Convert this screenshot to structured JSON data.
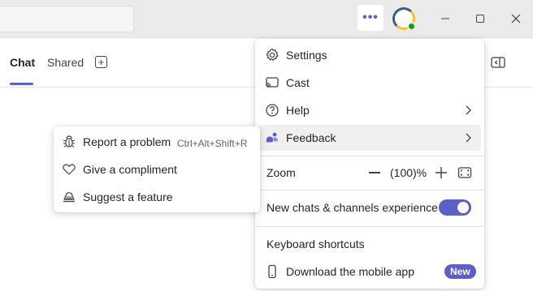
{
  "tabs": {
    "chat": "Chat",
    "shared": "Shared"
  },
  "menu": {
    "settings": "Settings",
    "cast": "Cast",
    "help": "Help",
    "feedback": "Feedback",
    "zoom_label": "Zoom",
    "zoom_value": "(100)%",
    "new_experience": "New chats & channels experience",
    "new_experience_enabled": true,
    "keyboard_shortcuts": "Keyboard shortcuts",
    "download_mobile": "Download the mobile app",
    "new_badge": "New"
  },
  "feedback_menu": {
    "report_problem": "Report a problem",
    "report_shortcut": "Ctrl+Alt+Shift+R",
    "give_compliment": "Give a compliment",
    "suggest_feature": "Suggest a feature"
  },
  "colors": {
    "accent": "#5b5fc7",
    "presence_available": "#13a10e"
  },
  "icons": [
    "more-icon",
    "minimize-icon",
    "maximize-icon",
    "close-icon",
    "add-tab-icon",
    "side-panel-icon",
    "gear-icon",
    "cast-icon",
    "help-icon",
    "feedback-icon",
    "chevron-right-icon",
    "zoom-out-icon",
    "zoom-in-icon",
    "fit-screen-icon",
    "phone-icon",
    "bug-icon",
    "heart-icon",
    "lightbulb-icon"
  ]
}
